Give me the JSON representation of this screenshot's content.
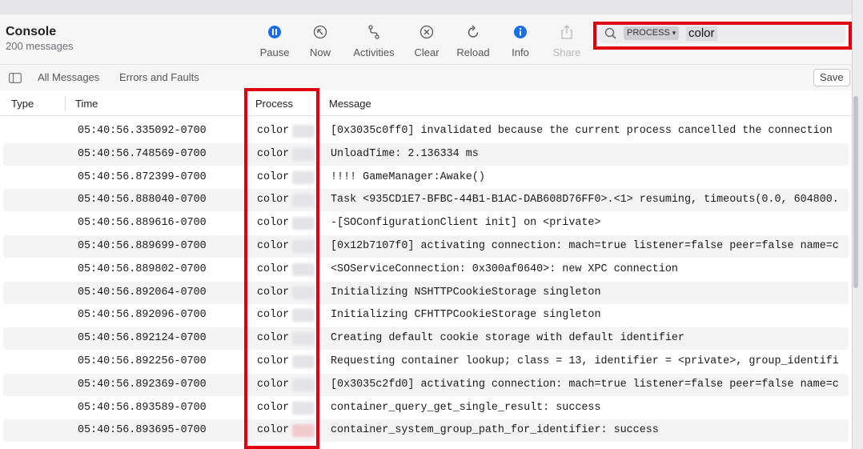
{
  "window": {
    "title": "Console",
    "subtitle": "200 messages"
  },
  "toolbar": {
    "buttons": [
      {
        "label": "Pause",
        "icon": "pause-circle-icon",
        "enabled": true
      },
      {
        "label": "Now",
        "icon": "arrow-up-left-circle-icon",
        "enabled": true
      },
      {
        "label": "Activities",
        "icon": "activities-icon",
        "enabled": true
      },
      {
        "label": "Clear",
        "icon": "x-circle-icon",
        "enabled": true
      },
      {
        "label": "Reload",
        "icon": "reload-icon",
        "enabled": true
      },
      {
        "label": "Info",
        "icon": "info-circle-icon",
        "enabled": true
      },
      {
        "label": "Share",
        "icon": "share-icon",
        "enabled": false
      }
    ]
  },
  "search": {
    "token": "PROCESS",
    "query": "color"
  },
  "filters": {
    "all_messages": "All Messages",
    "errors_and_faults": "Errors and Faults",
    "save": "Save"
  },
  "columns": {
    "type": "Type",
    "time": "Time",
    "process": "Process",
    "message": "Message"
  },
  "rows": [
    {
      "time": "05:40:56.335092-0700",
      "process": "color",
      "message": "[0x3035c0ff0] invalidated because the current process cancelled the connection"
    },
    {
      "time": "05:40:56.748569-0700",
      "process": "color",
      "message": "UnloadTime: 2.136334 ms"
    },
    {
      "time": "05:40:56.872399-0700",
      "process": "color",
      "message": "!!!! GameManager:Awake()"
    },
    {
      "time": "05:40:56.888040-0700",
      "process": "color",
      "message": "Task <935CD1E7-BFBC-44B1-B1AC-DAB608D76FF0>.<1> resuming, timeouts(0.0, 604800."
    },
    {
      "time": "05:40:56.889616-0700",
      "process": "color",
      "message": "-[SOConfigurationClient init]  on <private>"
    },
    {
      "time": "05:40:56.889699-0700",
      "process": "color",
      "message": "[0x12b7107f0] activating connection: mach=true listener=false peer=false name=c"
    },
    {
      "time": "05:40:56.889802-0700",
      "process": "color",
      "message": "<SOServiceConnection: 0x300af0640>: new XPC connection"
    },
    {
      "time": "05:40:56.892064-0700",
      "process": "color",
      "message": "Initializing NSHTTPCookieStorage singleton"
    },
    {
      "time": "05:40:56.892096-0700",
      "process": "color",
      "message": "Initializing CFHTTPCookieStorage singleton"
    },
    {
      "time": "05:40:56.892124-0700",
      "process": "color",
      "message": "Creating default cookie storage with default identifier"
    },
    {
      "time": "05:40:56.892256-0700",
      "process": "color",
      "message": "Requesting container lookup; class = 13, identifier = <private>, group_identifi"
    },
    {
      "time": "05:40:56.892369-0700",
      "process": "color",
      "message": "[0x3035c2fd0] activating connection: mach=true listener=false peer=false name=c"
    },
    {
      "time": "05:40:56.893589-0700",
      "process": "color",
      "message": "container_query_get_single_result: success"
    },
    {
      "time": "05:40:56.893695-0700",
      "process": "color",
      "message": "container_system_group_path_for_identifier: success"
    }
  ],
  "colors": {
    "highlight": "#e0000f",
    "accent": "#1a6fe8"
  }
}
